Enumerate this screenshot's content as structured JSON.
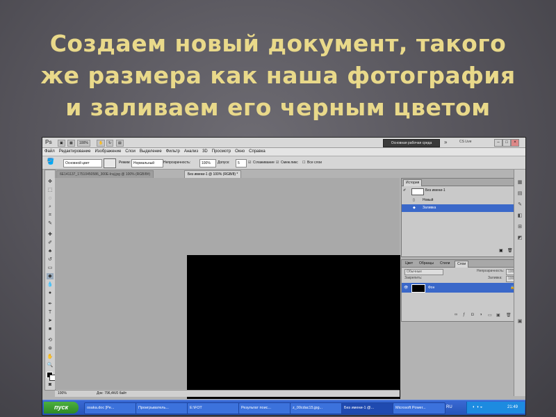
{
  "slide": {
    "title_lines": [
      "Создаем новый документ, такого",
      "же размера как наша фотография",
      "и заливаем его черным цветом"
    ]
  },
  "app": {
    "logo": "Ps",
    "zoom": "100%",
    "workspace_button": "Основная рабочая среда",
    "overflow": "»",
    "cs_live": "CS Live",
    "window_controls": [
      "–",
      "□",
      "×"
    ]
  },
  "menu": [
    "Файл",
    "Редактирование",
    "Изображение",
    "Слои",
    "Выделение",
    "Фильтр",
    "Анализ",
    "3D",
    "Просмотр",
    "Окно",
    "Справка"
  ],
  "options": {
    "fill_source": "Основной цвет",
    "mode_label": "Режим:",
    "mode_value": "Нормальный",
    "opacity_label": "Непрозрачность:",
    "opacity_value": "100%",
    "tolerance_label": "Допуск:",
    "tolerance_value": "5",
    "antialias": "Сглаживание",
    "contiguous": "Смеж.пикс",
    "all_layers": "Все слои"
  },
  "tabs": [
    {
      "label": "6E141137_17510450586_300E-Iraj.jpg @ 100% (RGB/8#)",
      "active": false
    },
    {
      "label": "Без имени-1 @ 100% (RGB/8) *",
      "active": true
    }
  ],
  "status": {
    "zoom": "100%",
    "doc": "Док: 796,4K/0 байт"
  },
  "history": {
    "tabs": [
      "История"
    ],
    "snapshot": "Без имени-1",
    "items": [
      {
        "label": "Новый",
        "selected": false
      },
      {
        "label": "Заливка",
        "selected": true
      }
    ]
  },
  "layers": {
    "tabs": [
      "Цвет",
      "Образцы",
      "Стили",
      "Слои"
    ],
    "blend_mode": "Обычные",
    "opacity_label": "Непрозрачность:",
    "opacity_value": "100%",
    "lock_label": "Закрепить:",
    "fill_label": "Заливка:",
    "fill_value": "100%",
    "layer_name": "Фон"
  },
  "taskbar": {
    "start": "пуск",
    "tasks": [
      {
        "label": "osaka.doc [Pe...",
        "active": false
      },
      {
        "label": "Проигрыватель...",
        "active": false
      },
      {
        "label": "E:\\FOT",
        "active": false
      },
      {
        "label": "Результат поис...",
        "active": false
      },
      {
        "label": "z_00cdac15.jpg...",
        "active": false
      },
      {
        "label": "Без имени-1 @...",
        "active": true
      },
      {
        "label": "Microsoft Power...",
        "active": false
      }
    ],
    "lang": "RU",
    "clock": "21:49"
  },
  "colors": {
    "title": "#e9d98a",
    "selection": "#3a68c9",
    "canvas": "#000000"
  }
}
